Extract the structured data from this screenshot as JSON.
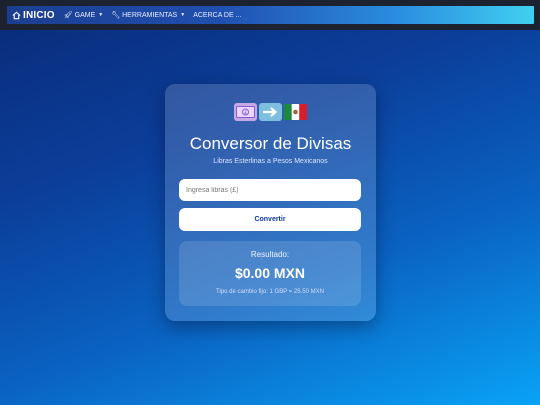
{
  "nav": {
    "brand": "INICIO",
    "items": [
      {
        "label": "GAME",
        "icon": "rocket-icon",
        "dropdown": true
      },
      {
        "label": "HERRAMIENTAS",
        "icon": "wrench-icon",
        "dropdown": true
      },
      {
        "label": "ACERCA DE ...",
        "icon": "",
        "dropdown": false
      }
    ]
  },
  "converter": {
    "icons": [
      "money-icon",
      "arrow-right-icon",
      "mexico-flag-icon"
    ],
    "title": "Conversor de Divisas",
    "subtitle": "Libras Esterlinas a Pesos Mexicanos",
    "input_placeholder": "Ingresa libras (£)",
    "input_value": "",
    "button_label": "Convertir",
    "result_label": "Resultado:",
    "result_value": "$0.00 MXN",
    "rate_text": "Tipo de cambio fijo: 1 GBP = 25.50 MXN"
  },
  "colors": {
    "accent": "#123a9a",
    "nav_gradient_start": "#1b3e8f",
    "nav_gradient_end": "#3fd0f0",
    "background_start": "#0a2a78",
    "background_end": "#09a3f5"
  }
}
